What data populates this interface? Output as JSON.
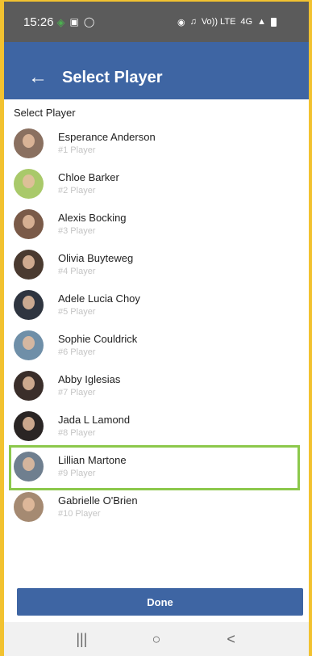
{
  "status_bar": {
    "time": "15:26",
    "left_icons": [
      "leaf-icon",
      "image-icon",
      "shield-icon"
    ],
    "right_icons": [
      "alarm-icon",
      "mute-icon",
      "volte-icon",
      "4g-icon",
      "signal-icon",
      "battery-icon"
    ],
    "volte_text": "Vo)) LTE",
    "network_text": "4G"
  },
  "app_bar": {
    "back_glyph": "←",
    "title": "Select Player",
    "color": "#3e65a3"
  },
  "section_label": "Select Player",
  "players": [
    {
      "name": "Esperance Anderson",
      "sub": "#1 Player",
      "avatar_bg": "#8a7060"
    },
    {
      "name": "Chloe Barker",
      "sub": "#2 Player",
      "avatar_bg": "#a9c96a"
    },
    {
      "name": "Alexis Bocking",
      "sub": "#3 Player",
      "avatar_bg": "#7a5a48"
    },
    {
      "name": "Olivia Buyteweg",
      "sub": "#4 Player",
      "avatar_bg": "#4a3a30"
    },
    {
      "name": "Adele Lucia Choy",
      "sub": "#5 Player",
      "avatar_bg": "#2f3540"
    },
    {
      "name": "Sophie Couldrick",
      "sub": "#6 Player",
      "avatar_bg": "#6f8fa8"
    },
    {
      "name": "Abby Iglesias",
      "sub": "#7 Player",
      "avatar_bg": "#3a2e2a"
    },
    {
      "name": "Jada L Lamond",
      "sub": "#8 Player",
      "avatar_bg": "#2a2524"
    },
    {
      "name": "Lillian Martone",
      "sub": "#9 Player",
      "avatar_bg": "#6f7f8f"
    },
    {
      "name": "Gabrielle O'Brien",
      "sub": "#10 Player",
      "avatar_bg": "#a58a72"
    }
  ],
  "selected_index": 8,
  "highlight_color": "#8cc84b",
  "done_label": "Done",
  "nav": {
    "recents_glyph": "|||",
    "home_glyph": "○",
    "back_glyph": "<"
  }
}
